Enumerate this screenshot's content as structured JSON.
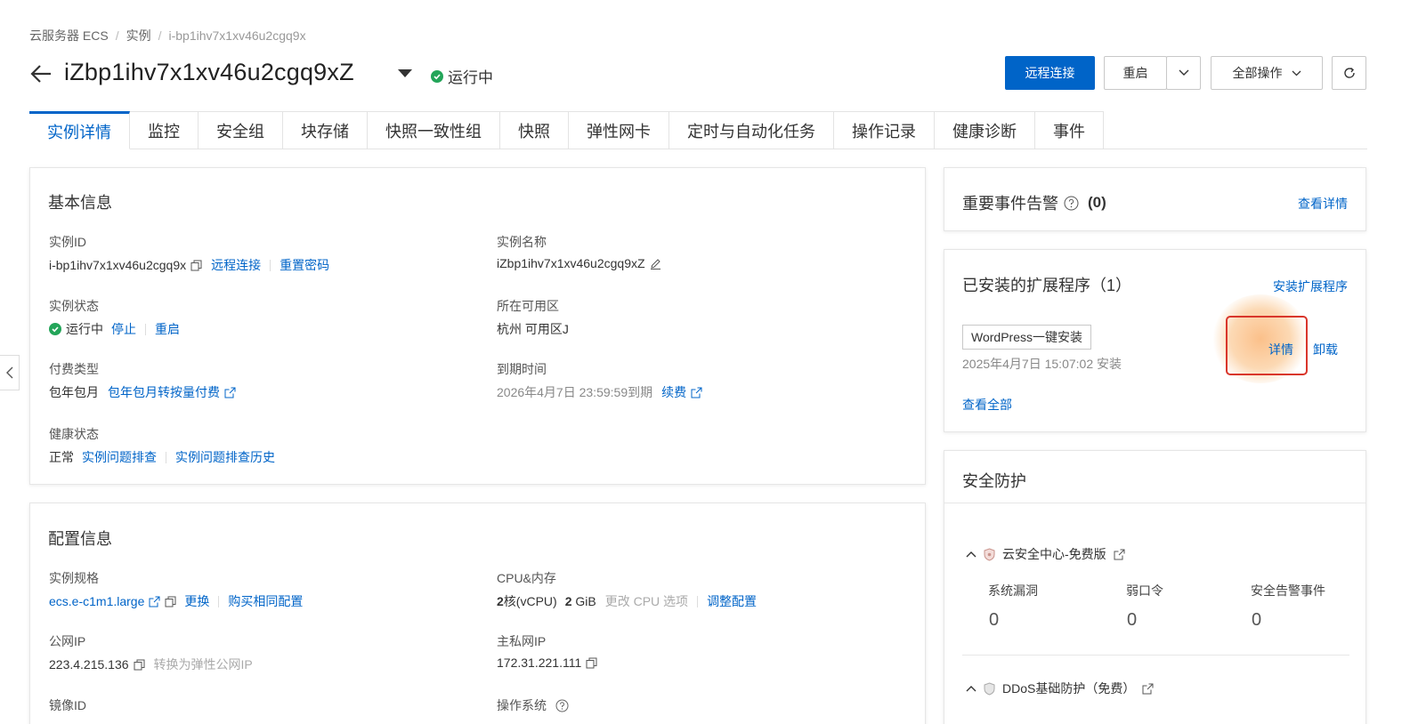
{
  "breadcrumb": [
    "云服务器 ECS",
    "实例",
    "i-bp1ihv7x1xv46u2cgq9x"
  ],
  "header": {
    "title": "iZbp1ihv7x1xv46u2cgq9xZ",
    "status": "运行中",
    "remote_connect": "远程连接",
    "restart": "重启",
    "all_ops": "全部操作"
  },
  "tabs": [
    "实例详情",
    "监控",
    "安全组",
    "块存储",
    "快照一致性组",
    "快照",
    "弹性网卡",
    "定时与自动化任务",
    "操作记录",
    "健康诊断",
    "事件"
  ],
  "basic": {
    "title": "基本信息",
    "instance_id_label": "实例ID",
    "instance_id": "i-bp1ihv7x1xv46u2cgq9x",
    "remote_connect": "远程连接",
    "reset_password": "重置密码",
    "instance_name_label": "实例名称",
    "instance_name": "iZbp1ihv7x1xv46u2cgq9xZ",
    "state_label": "实例状态",
    "state": "运行中",
    "stop": "停止",
    "restart": "重启",
    "zone_label": "所在可用区",
    "zone": "杭州 可用区J",
    "billing_label": "付费类型",
    "billing": "包年包月",
    "billing_convert": "包年包月转按量付费",
    "expire_label": "到期时间",
    "expire": "2026年4月7日 23:59:59到期",
    "renew": "续费",
    "health_label": "健康状态",
    "health": "正常",
    "troubleshoot": "实例问题排查",
    "troubleshoot_history": "实例问题排查历史"
  },
  "config": {
    "title": "配置信息",
    "spec_label": "实例规格",
    "spec": "ecs.e-c1m1.large",
    "change": "更换",
    "buy_same": "购买相同配置",
    "cpu_label": "CPU&内存",
    "cpu_num": "2",
    "cpu_unit": "核(vCPU)",
    "mem_num": "2",
    "mem_unit": " GiB",
    "change_cpu": "更改 CPU 选项",
    "adjust": "调整配置",
    "public_ip_label": "公网IP",
    "public_ip": "223.4.215.136",
    "convert_eip": "转换为弹性公网IP",
    "private_ip_label": "主私网IP",
    "private_ip": "172.31.221.111",
    "image_label": "镜像ID",
    "os_label": "操作系统"
  },
  "events": {
    "title": "重要事件告警",
    "count": "(0)",
    "view": "查看详情"
  },
  "extensions": {
    "title": "已安装的扩展程序（1）",
    "install": "安装扩展程序",
    "item_name": "WordPress一键安装",
    "item_time": "2025年4月7日 15:07:02 安装",
    "detail": "详情",
    "uninstall": "卸载",
    "view_all": "查看全部"
  },
  "security": {
    "title": "安全防护",
    "center": "云安全中心-免费版",
    "cols": [
      "系统漏洞",
      "弱口令",
      "安全告警事件"
    ],
    "vals": [
      "0",
      "0",
      "0"
    ],
    "ddos": "DDoS基础防护（免费）"
  },
  "colors": {
    "accent": "#0064c8",
    "ok": "#23a559",
    "highlight": "#d9362b"
  }
}
